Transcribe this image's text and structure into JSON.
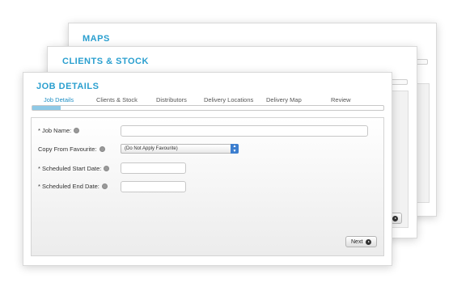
{
  "cards": {
    "maps": {
      "title": "MAPS"
    },
    "clients": {
      "title": "CLIENTS & STOCK"
    },
    "job": {
      "title": "JOB DETAILS"
    }
  },
  "tabs": [
    {
      "label": "Job Details",
      "active": true
    },
    {
      "label": "Clients & Stock",
      "active": false
    },
    {
      "label": "Distributors",
      "active": false
    },
    {
      "label": "Delivery Locations",
      "active": false
    },
    {
      "label": "Delivery Map",
      "active": false
    },
    {
      "label": "Review",
      "active": false
    }
  ],
  "progress": {
    "fraction": 0.08
  },
  "form": {
    "job_name": {
      "label": "* Job Name:",
      "value": ""
    },
    "copy_from": {
      "label": "Copy From Favourite:",
      "value": "(Do Not Apply Favourite)"
    },
    "start_date": {
      "label": "* Scheduled Start Date:",
      "value": ""
    },
    "end_date": {
      "label": "* Scheduled End Date:",
      "value": ""
    }
  },
  "buttons": {
    "next": "Next"
  },
  "colors": {
    "accent": "#2a9fcf",
    "select_arrow": "#3c7ecf"
  }
}
